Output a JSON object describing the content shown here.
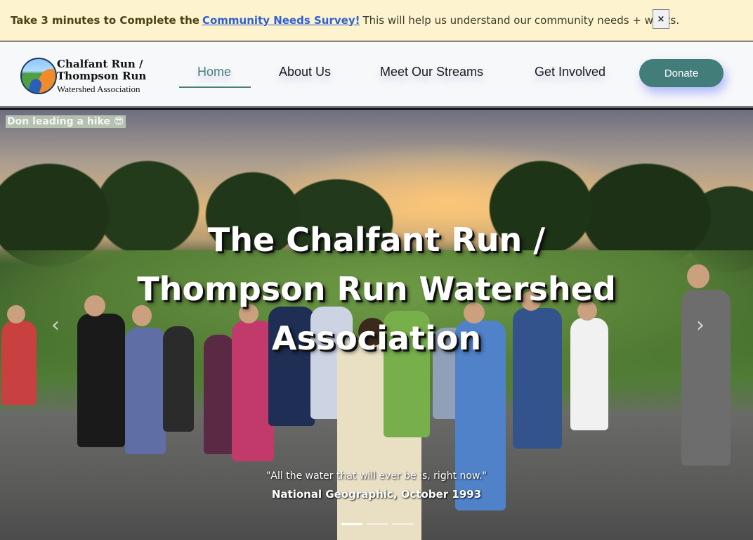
{
  "banner": {
    "lead": "Take 3 minutes to Complete the",
    "link": "Community Needs Survey!",
    "rest": "This will help us understand our community needs + wants.",
    "close": "×"
  },
  "logo": {
    "title": "Chalfant Run / Thompson Run",
    "subtitle": "Watershed Association"
  },
  "nav": {
    "items": [
      {
        "label": "Home"
      },
      {
        "label": "About Us"
      },
      {
        "label": "Meet Our Streams"
      },
      {
        "label": "Get Involved"
      }
    ],
    "donate": "Donate"
  },
  "hero": {
    "caption": "Don leading a hike 😎",
    "title": "The Chalfant Run / Thompson Run Watershed Association",
    "quote": "\"All the water that will ever be is, right now.\"",
    "attribution": "National Geographic, October 1993",
    "prev": "‹",
    "next": "›",
    "slides_total": 3,
    "active_slide": 1
  }
}
